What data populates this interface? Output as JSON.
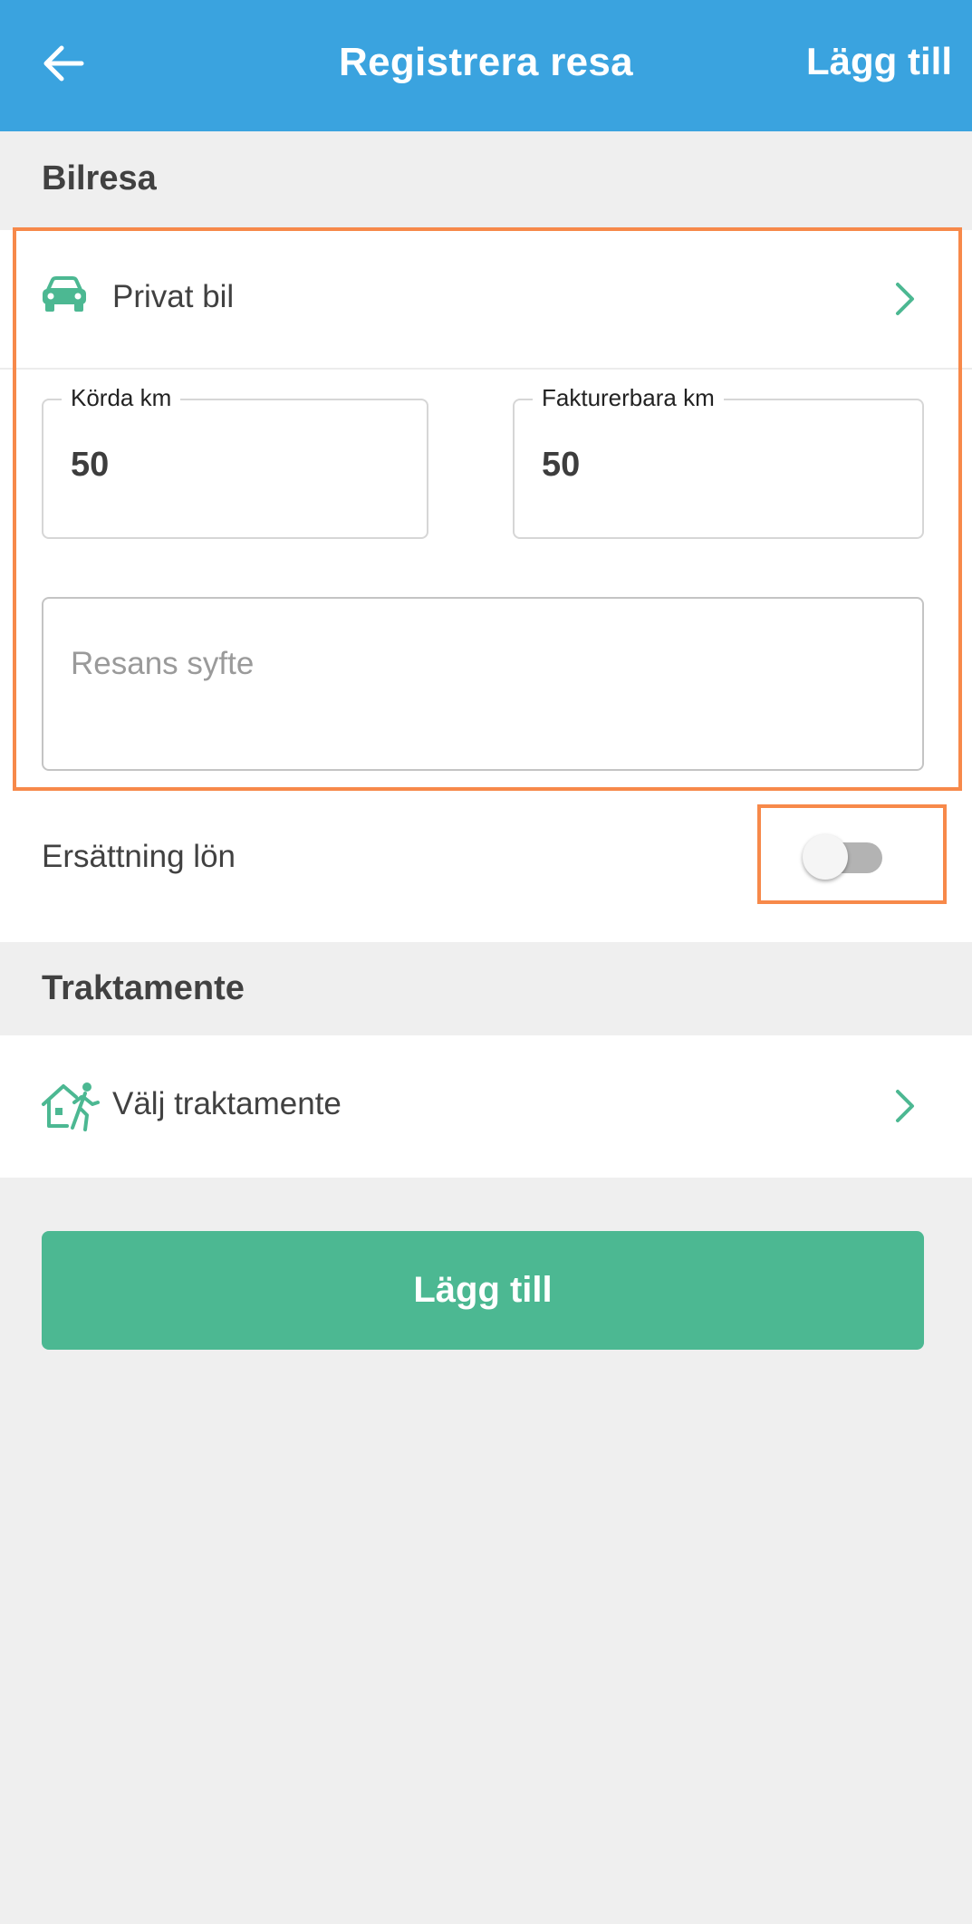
{
  "app_bar": {
    "title": "Registrera resa",
    "action_label": "Lägg till",
    "back_icon": "arrow-left-icon",
    "color": "#3aa3df"
  },
  "car_trip": {
    "section_title": "Bilresa",
    "vehicle": {
      "label": "Privat bil",
      "icon": "car-icon"
    },
    "driven_km": {
      "label": "Körda km",
      "value": "50"
    },
    "billable_km": {
      "label": "Fakturerbara km",
      "value": "50"
    },
    "purpose": {
      "placeholder": "Resans syfte",
      "value": ""
    },
    "salary_compensation": {
      "label": "Ersättning lön",
      "enabled": false
    }
  },
  "allowance": {
    "section_title": "Traktamente",
    "select_label": "Välj traktamente",
    "icon": "house-walking-person-icon"
  },
  "submit_button": {
    "label": "Lägg till",
    "color": "#4cb892"
  },
  "highlight_color": "#f7894a"
}
